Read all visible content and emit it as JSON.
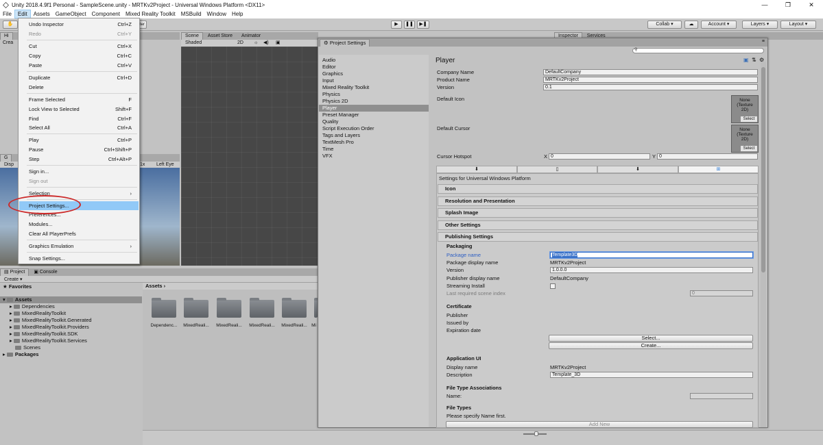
{
  "titlebar": {
    "text": "Unity 2018.4.9f1 Personal - SampleScene.unity - MRTKv2Project - Universal Windows Platform <DX11>"
  },
  "menubar": [
    "File",
    "Edit",
    "Assets",
    "GameObject",
    "Component",
    "Mixed Reality Toolkit",
    "MSBuild",
    "Window",
    "Help"
  ],
  "toolbar": {
    "right_btns": [
      "Collab ▾",
      "Account ▾",
      "Layers ▾",
      "Layout ▾"
    ],
    "center_label": "Center"
  },
  "scene": {
    "tabs": [
      "Scene",
      "Asset Store",
      "Animator"
    ],
    "shading": "Shaded",
    "mode": "2D"
  },
  "top_tabs": {
    "inspector": "Inspector",
    "services": "Services",
    "leftpane": "Hi",
    "create": "Crea",
    "game": "G",
    "display": "Disp",
    "scale": "1x",
    "leftey": "Left Eye"
  },
  "editmenu": [
    {
      "label": "Undo Inspector",
      "shortcut": "Ctrl+Z"
    },
    {
      "label": "Redo",
      "shortcut": "Ctrl+Y",
      "disabled": true
    },
    {
      "label": "Cut",
      "shortcut": "Ctrl+X"
    },
    {
      "label": "Copy",
      "shortcut": "Ctrl+C"
    },
    {
      "label": "Paste",
      "shortcut": "Ctrl+V"
    },
    {
      "label": "Duplicate",
      "shortcut": "Ctrl+D"
    },
    {
      "label": "Delete",
      "shortcut": ""
    },
    {
      "label": "Frame Selected",
      "shortcut": "F"
    },
    {
      "label": "Lock View to Selected",
      "shortcut": "Shift+F"
    },
    {
      "label": "Find",
      "shortcut": "Ctrl+F"
    },
    {
      "label": "Select All",
      "shortcut": "Ctrl+A"
    },
    {
      "label": "Play",
      "shortcut": "Ctrl+P"
    },
    {
      "label": "Pause",
      "shortcut": "Ctrl+Shift+P"
    },
    {
      "label": "Step",
      "shortcut": "Ctrl+Alt+P"
    },
    {
      "label": "Sign in...",
      "shortcut": ""
    },
    {
      "label": "Sign out",
      "shortcut": "",
      "disabled": true
    },
    {
      "label": "Selection",
      "shortcut": "›"
    },
    {
      "label": "Project Settings...",
      "shortcut": "",
      "highlight": true
    },
    {
      "label": "Preferences...",
      "shortcut": ""
    },
    {
      "label": "Modules...",
      "shortcut": ""
    },
    {
      "label": "Clear All PlayerPrefs",
      "shortcut": ""
    },
    {
      "label": "Graphics Emulation",
      "shortcut": "›"
    },
    {
      "label": "Snap Settings...",
      "shortcut": ""
    }
  ],
  "project": {
    "tabs": [
      "Project",
      "Console"
    ],
    "create": "Create ▾",
    "favorites": "Favorites",
    "assets_root": "Assets",
    "tree": [
      "Dependencies",
      "MixedRealityToolkit",
      "MixedRealityToolkit.Generated",
      "MixedRealityToolkit.Providers",
      "MixedRealityToolkit.SDK",
      "MixedRealityToolkit.Services",
      "Scenes"
    ],
    "packages": "Packages",
    "breadcrumb": "Assets ›",
    "grid": [
      "Dependenc...",
      "MixedReali...",
      "MixedReali...",
      "MixedReali...",
      "MixedReali...",
      "Mi"
    ]
  },
  "psettings": {
    "title": "Project Settings",
    "categories": [
      "Audio",
      "Editor",
      "Graphics",
      "Input",
      "Mixed Reality Toolkit",
      "Physics",
      "Physics 2D",
      "Player",
      "Preset Manager",
      "Quality",
      "Script Execution Order",
      "Tags and Layers",
      "TextMesh Pro",
      "Time",
      "VFX"
    ],
    "selected": "Player",
    "header": "Player",
    "company_label": "Company Name",
    "company": "DefaultCompany",
    "product_label": "Product Name",
    "product": "MRTKv2Project",
    "version_label": "Version",
    "version": "0.1",
    "icon_label": "Default Icon",
    "cursor_label": "Default Cursor",
    "none_texture": "None\n(Texture\n2D)",
    "select": "Select",
    "hotspot_label": "Cursor Hotspot",
    "x_label": "X",
    "x_val": "0",
    "y_label": "Y",
    "y_val": "0",
    "platform_title": "Settings for Universal Windows Platform",
    "foldouts": [
      "Icon",
      "Resolution and Presentation",
      "Splash Image",
      "Other Settings",
      "Publishing Settings"
    ],
    "packaging": "Packaging",
    "pkg_name_label": "Package name",
    "pkg_name": "Template3D",
    "pkg_disp_label": "Package display name",
    "pkg_disp": "MRTKv2Project",
    "pkg_ver_label": "Version",
    "pkg_ver": "1.0.0.0",
    "pub_disp_label": "Publisher display name",
    "pub_disp": "DefaultCompany",
    "streaming_label": "Streaming Install",
    "last_scene_label": "Last required scene index",
    "last_scene": "0",
    "certificate": "Certificate",
    "publisher_label": "Publisher",
    "issued_label": "Issued by",
    "expiry_label": "Expiration date",
    "select_btn": "Select...",
    "create_btn": "Create...",
    "app_ui": "Application UI",
    "disp_name_label": "Display name",
    "disp_name": "MRTKv2Project",
    "desc_label": "Description",
    "desc": "Template_3D",
    "fta": "File Type Associations",
    "name_label": "Name:",
    "file_types": "File Types",
    "specify": "Please specify Name first.",
    "add_new": "Add New"
  }
}
